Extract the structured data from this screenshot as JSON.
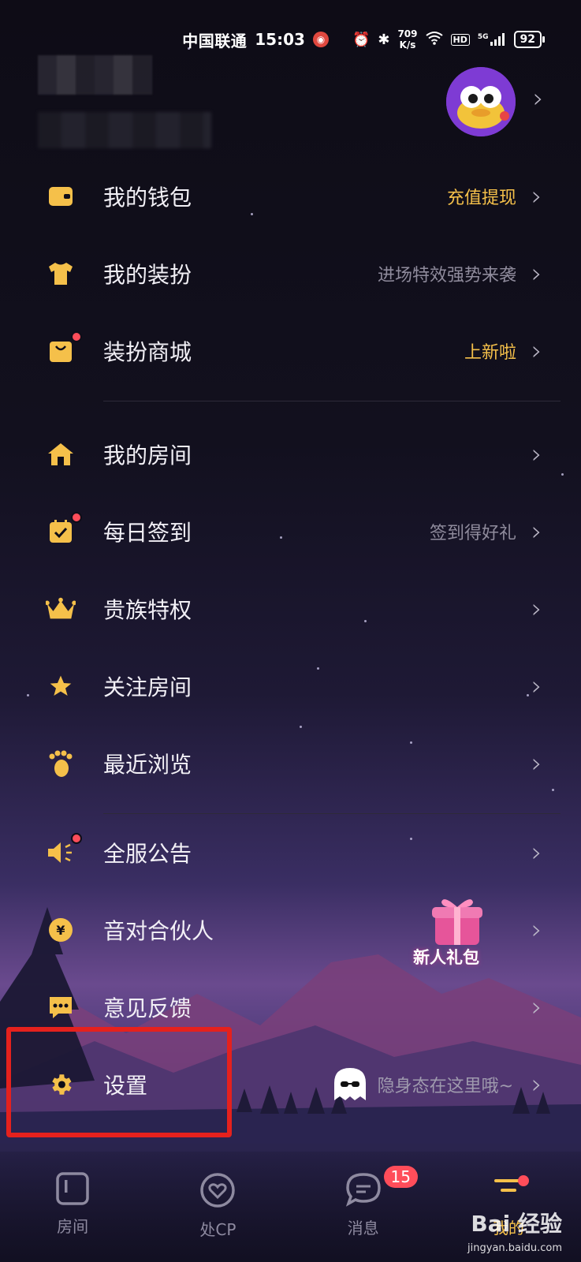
{
  "status_bar": {
    "carrier": "中国联通",
    "time": "15:03",
    "net_speed_value": "709",
    "net_speed_unit": "K/s",
    "hd_label": "HD",
    "signal_label": "5G",
    "battery": "92"
  },
  "menu": {
    "wallet": {
      "label": "我的钱包",
      "hint": "充值提现"
    },
    "outfit": {
      "label": "我的装扮",
      "hint": "进场特效强势来袭"
    },
    "mall": {
      "label": "装扮商城",
      "hint": "上新啦"
    },
    "my_room": {
      "label": "我的房间",
      "hint": ""
    },
    "checkin": {
      "label": "每日签到",
      "hint": "签到得好礼"
    },
    "noble": {
      "label": "贵族特权",
      "hint": ""
    },
    "follow_room": {
      "label": "关注房间",
      "hint": ""
    },
    "recent": {
      "label": "最近浏览",
      "hint": ""
    },
    "notice": {
      "label": "全服公告",
      "hint": ""
    },
    "partner": {
      "label": "音对合伙人",
      "hint": ""
    },
    "feedback": {
      "label": "意见反馈",
      "hint": ""
    },
    "settings": {
      "label": "设置",
      "hint": "隐身态在这里哦~"
    }
  },
  "gift": {
    "label": "新人礼包"
  },
  "tabbar": {
    "tabs": [
      {
        "label": "房间",
        "icon": "room-icon"
      },
      {
        "label": "处CP",
        "icon": "heart-icon"
      },
      {
        "label": "消息",
        "icon": "message-icon",
        "badge": "15"
      },
      {
        "label": "我的",
        "icon": "me-icon"
      }
    ]
  },
  "watermark": {
    "main": "Bai 经验",
    "sub": "jingyan.baidu.com"
  },
  "colors": {
    "accent": "#f5c04a",
    "badge": "#ff4d5a",
    "highlight": "#e5211d"
  }
}
